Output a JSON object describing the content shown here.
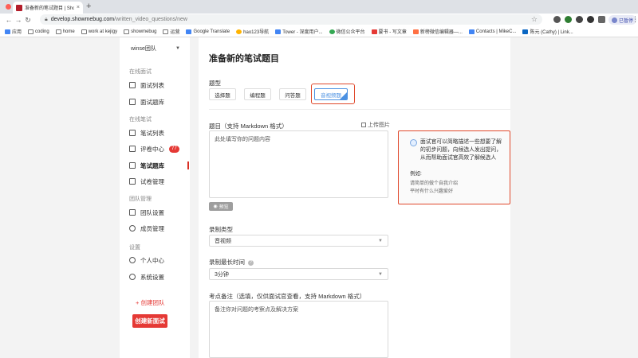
{
  "browser": {
    "tab_title": "准备新的笔试题目 | ShowMeBu...",
    "url_host": "develop.showmebug.com",
    "url_path": "/written_video_questions/new",
    "profile_label": "已暂停",
    "bookmarks": [
      "应用",
      "coding",
      "home",
      "work at kejigy",
      "showmebug",
      "运营",
      "Google Translate",
      "hao123导航",
      "Tower - 深度用户...",
      "微信公众平台",
      "要书 - 写文章",
      "新榜微信编辑器—...",
      "Contacts | MikeC...",
      "陈元 (Cathy) | Link..."
    ]
  },
  "sidebar": {
    "team": "winse团队",
    "sections": {
      "online": "在线面试",
      "written": "在线笔试",
      "team": "团队管理",
      "settings": "设置"
    },
    "items": {
      "interview_list": "面试列表",
      "interview_bank": "面试题库",
      "written_list": "笔试列表",
      "review_center": "评卷中心",
      "review_count": "77",
      "written_bank": "笔试题库",
      "paper_manage": "试卷管理",
      "team_settings": "团队设置",
      "member_manage": "成员管理",
      "profile": "个人中心",
      "system_settings": "系统设置"
    },
    "create_team": "+ 创建团队",
    "create_interview": "创建新面试"
  },
  "main": {
    "title": "准备新的笔试题目",
    "type_label": "题型",
    "types": [
      "选择题",
      "编程题",
      "问答题",
      "音视频题"
    ],
    "question_label": "题目（支持 Markdown 格式）",
    "upload_label": "上传图片",
    "question_placeholder": "此处填写你的问题内容",
    "preview_label": "预览",
    "record_type_label": "录制类型",
    "record_type_value": "音视频",
    "max_duration_label": "录制最长时间",
    "max_duration_value": "3分钟",
    "note_label": "考点备注（选填，仅供面试官查看，支持 Markdown 格式）",
    "note_placeholder": "备注你对问题的考察点及解决方案"
  },
  "tip": {
    "text": "面试官可以简略描述一些想要了解的初步问题，向候选人发出提问，从而帮助面试官高效了解候选人",
    "example_title": "例如:",
    "examples": [
      "请简单的做个自我介绍",
      "平时有什么兴趣爱好"
    ]
  },
  "colors": {
    "accent": "#e53935",
    "selected_blue": "#4a90e2",
    "highlight": "#e0482b"
  }
}
